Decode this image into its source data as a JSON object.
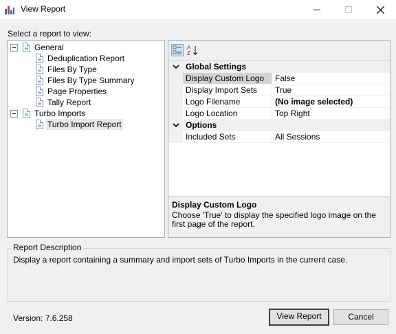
{
  "window": {
    "title": "View Report",
    "controls": [
      "minimize",
      "maximize",
      "close"
    ]
  },
  "tree": {
    "caption": "Select a report to view:",
    "groups": [
      {
        "label": "General",
        "items": [
          "Deduplication Report",
          "Files By Type",
          "Files By Type Summary",
          "Page Properties",
          "Tally Report"
        ]
      },
      {
        "label": "Turbo Imports",
        "items": [
          "Turbo Import Report"
        ]
      }
    ],
    "selected": "Turbo Import Report"
  },
  "property_grid": {
    "toolbar": [
      "categorized-icon",
      "alphabetical-icon"
    ],
    "categories": [
      {
        "label": "Global Settings",
        "rows": [
          {
            "name": "Display Custom Logo",
            "value": "False"
          },
          {
            "name": "Display Import Sets",
            "value": "True"
          },
          {
            "name": "Logo Filename",
            "value": "(No image selected)"
          },
          {
            "name": "Logo Location",
            "value": "Top Right"
          }
        ]
      },
      {
        "label": "Options",
        "rows": [
          {
            "name": "Included Sets",
            "value": "All Sessions"
          }
        ]
      }
    ],
    "selected_property": "Display Custom Logo",
    "help": {
      "title": "Display Custom Logo",
      "text": "Choose 'True' to display the specified logo image on the first page of the report."
    }
  },
  "description": {
    "caption": "Report Description",
    "text": "Display a report containing a summary and import sets of Turbo Imports in the current case."
  },
  "footer": {
    "version": "Version: 7.6.258",
    "view_button": "View Report",
    "cancel_button": "Cancel"
  },
  "colors": {
    "window_bg": "#f0f0f0",
    "selected_row": "#d3d3d3",
    "app_icon_blue": "#2b6fc4",
    "app_icon_red": "#d43d3d"
  }
}
